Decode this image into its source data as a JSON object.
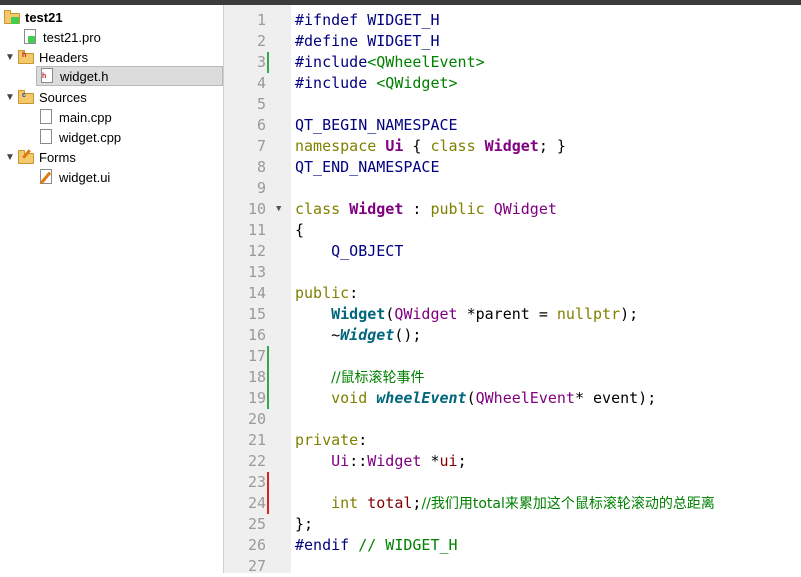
{
  "project_tree": {
    "project": {
      "label": "test21",
      "icon": "qt-project-folder-icon"
    },
    "items": [
      {
        "label": "test21.pro",
        "icon": "pro-file-icon"
      },
      {
        "label": "Headers",
        "icon": "headers-folder-icon"
      },
      {
        "label": "widget.h",
        "icon": "header-file-icon",
        "selected": true
      },
      {
        "label": "Sources",
        "icon": "sources-folder-icon"
      },
      {
        "label": "main.cpp",
        "icon": "cpp-file-icon"
      },
      {
        "label": "widget.cpp",
        "icon": "cpp-file-icon"
      },
      {
        "label": "Forms",
        "icon": "forms-folder-icon"
      },
      {
        "label": "widget.ui",
        "icon": "ui-file-icon"
      }
    ]
  },
  "editor": {
    "line_numbers": [
      "1",
      "2",
      "3",
      "4",
      "5",
      "6",
      "7",
      "8",
      "9",
      "10",
      "11",
      "12",
      "13",
      "14",
      "15",
      "16",
      "17",
      "18",
      "19",
      "20",
      "21",
      "22",
      "23",
      "24",
      "25",
      "26",
      "27"
    ],
    "modified_lines": [
      "3",
      "17",
      "18",
      "19"
    ],
    "error_lines": [
      "23",
      "24"
    ],
    "lines": [
      "#ifndef WIDGET_H",
      "#define WIDGET_H",
      "#include<QWheelEvent>",
      "#include <QWidget>",
      "",
      "QT_BEGIN_NAMESPACE",
      "namespace Ui { class Widget; }",
      "QT_END_NAMESPACE",
      "",
      "class Widget : public QWidget",
      "{",
      "    Q_OBJECT",
      "",
      "public:",
      "    Widget(QWidget *parent = nullptr);",
      "    ~Widget();",
      "",
      "    //鼠标滚轮事件",
      "    void wheelEvent(QWheelEvent* event);",
      "",
      "private:",
      "    Ui::Widget *ui;",
      "",
      "    int total;//我们用total来累加这个鼠标滚轮滚动的总距离",
      "};",
      "#endif // WIDGET_H",
      ""
    ],
    "tokens": {
      "l1_pp": "#ifndef",
      "l1_rest": " WIDGET_H",
      "l2_pp": "#define",
      "l2_rest": " WIDGET_H",
      "l3_pp": "#include",
      "l3_inc": "<QWheelEvent>",
      "l4_pp": "#include",
      "l4_sp": " ",
      "l4_inc": "<QWidget>",
      "l6": "QT_BEGIN_NAMESPACE",
      "l7_kw1": "namespace",
      "l7_ui": "Ui",
      "l7_b1": " { ",
      "l7_kw2": "class",
      "l7_sp": " ",
      "l7_cls": "Widget",
      "l7_b2": "; }",
      "l8": "QT_END_NAMESPACE",
      "l10_kw": "class",
      "l10_sp": " ",
      "l10_cls": "Widget",
      "l10_c": " : ",
      "l10_kw2": "public",
      "l10_sp2": " ",
      "l10_ty": "QWidget",
      "l11": "{",
      "l12": "    Q_OBJECT",
      "l14_kw": "public",
      "l14_c": ":",
      "l15_ind": "    ",
      "l15_fn": "Widget",
      "l15_p": "(",
      "l15_ty": "QWidget",
      "l15_r": " *parent = ",
      "l15_kw": "nullptr",
      "l15_e": ");",
      "l16_ind": "    ~",
      "l16_fn": "Widget",
      "l16_e": "();",
      "l18_ind": "    ",
      "l18_cm": "//鼠标滚轮事件",
      "l19_ind": "    ",
      "l19_kw": "void",
      "l19_sp": " ",
      "l19_fn": "wheelEvent",
      "l19_p": "(",
      "l19_ty": "QWheelEvent",
      "l19_r": "* event);",
      "l22_ind": "    ",
      "l22_ui": "Ui",
      "l22_s": "::",
      "l22_ty": "Widget",
      "l22_r": " *",
      "l22_mem": "ui",
      "l22_e": ";",
      "l24_ind": "    ",
      "l24_kw": "int",
      "l24_sp": " ",
      "l24_mem": "total",
      "l24_s": ";",
      "l24_cm": "//我们用total来累加这个鼠标滚轮滚动的总距离",
      "l25": "};",
      "l26_pp": "#endif",
      "l26_sp": " ",
      "l26_cm": "// WIDGET_H",
      "l21_kw": "private",
      "l21_c": ":"
    }
  },
  "colors": {
    "modified_marker": "#2fa84f",
    "error_marker": "#e02020",
    "keyword": "#808000",
    "type": "#800080",
    "function": "#00677c",
    "comment": "#008000",
    "preprocessor": "#000080",
    "gutter_bg": "#efefef",
    "selection_bg": "#dcdcdc"
  }
}
